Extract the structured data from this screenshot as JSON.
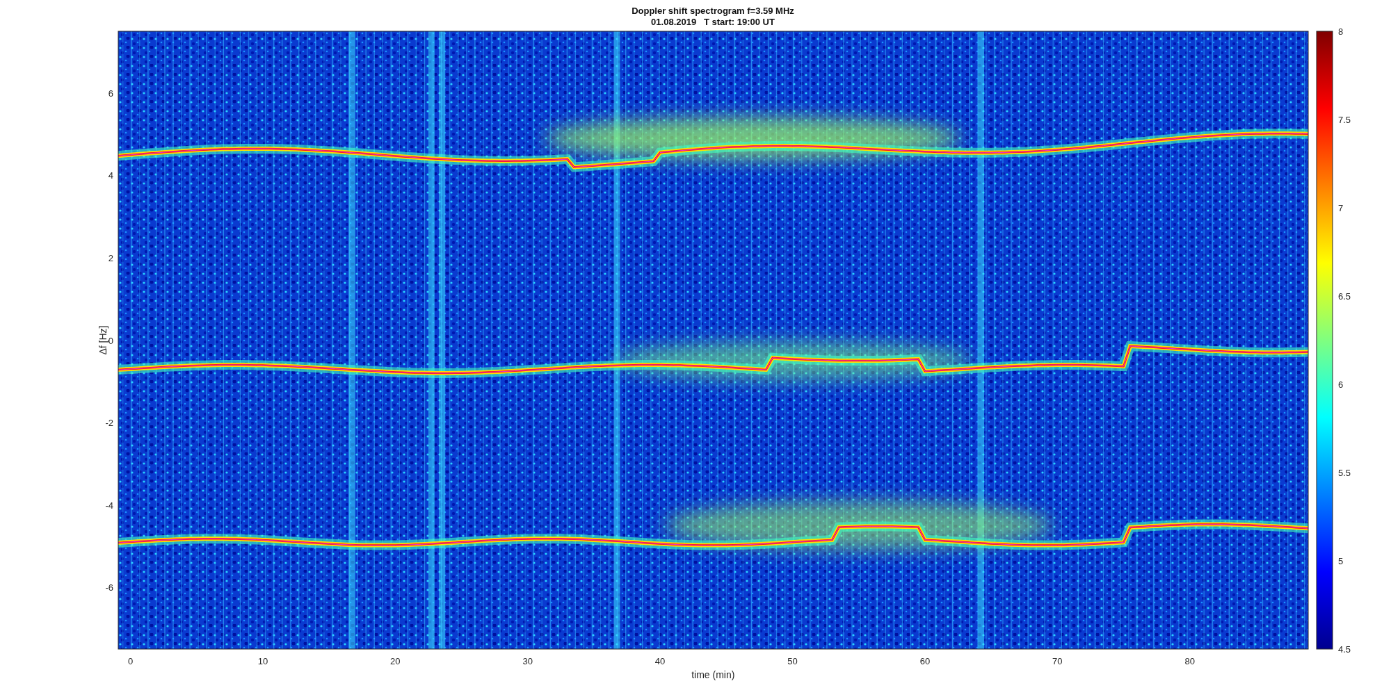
{
  "figure": {
    "title": "Doppler shift spectrogram f=3.59 MHz",
    "subtitle": "01.08.2019   T start: 19:00 UT"
  },
  "axes": {
    "xlabel": "time (min)",
    "ylabel": "Δf [Hz]",
    "xticks": [
      "0",
      "10",
      "20",
      "30",
      "40",
      "50",
      "60",
      "70",
      "80"
    ],
    "yticks": [
      "6",
      "4",
      "2",
      "0",
      "-2",
      "-4",
      "-6"
    ]
  },
  "colorbar": {
    "ticks": [
      "8",
      "7.5",
      "7",
      "6.5",
      "6",
      "5.5",
      "5",
      "4.5"
    ]
  }
}
